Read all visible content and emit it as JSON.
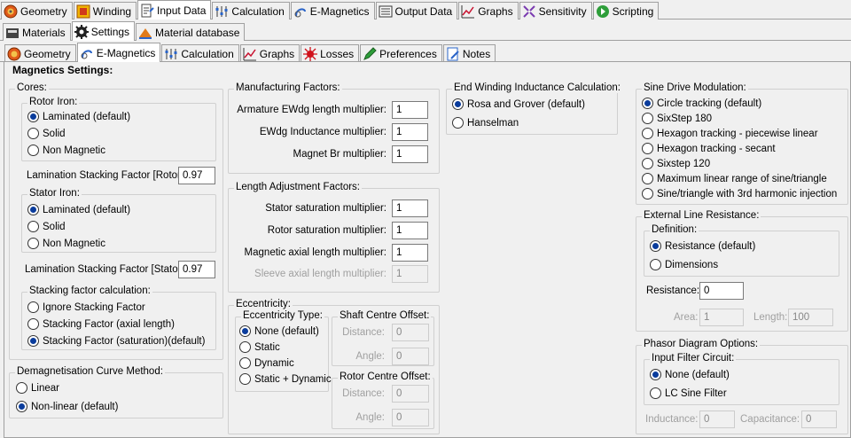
{
  "top_tabs": [
    {
      "label": "Geometry",
      "icon": "geometry-icon"
    },
    {
      "label": "Winding",
      "icon": "winding-icon"
    },
    {
      "label": "Input Data",
      "icon": "input-data-icon"
    },
    {
      "label": "Calculation",
      "icon": "calculation-icon"
    },
    {
      "label": "E-Magnetics",
      "icon": "e-magnetics-icon"
    },
    {
      "label": "Output Data",
      "icon": "output-data-icon"
    },
    {
      "label": "Graphs",
      "icon": "graphs-icon"
    },
    {
      "label": "Sensitivity",
      "icon": "sensitivity-icon"
    },
    {
      "label": "Scripting",
      "icon": "scripting-icon"
    }
  ],
  "second_tabs": [
    {
      "label": "Materials"
    },
    {
      "label": "Settings"
    },
    {
      "label": "Material database"
    }
  ],
  "third_tabs": [
    {
      "label": "Geometry"
    },
    {
      "label": "E-Magnetics"
    },
    {
      "label": "Calculation"
    },
    {
      "label": "Graphs"
    },
    {
      "label": "Losses"
    },
    {
      "label": "Preferences"
    },
    {
      "label": "Notes"
    }
  ],
  "title": "Magnetics Settings:",
  "cores": {
    "legend": "Cores:",
    "rotor_iron": {
      "legend": "Rotor Iron:",
      "options": [
        "Laminated (default)",
        "Solid",
        "Non Magnetic"
      ],
      "selected": 0
    },
    "rotor_stacking_label": "Lamination Stacking Factor [Rotor]:",
    "rotor_stacking_value": "0.97",
    "stator_iron": {
      "legend": "Stator Iron:",
      "options": [
        "Laminated (default)",
        "Solid",
        "Non Magnetic"
      ],
      "selected": 0
    },
    "stator_stacking_label": "Lamination Stacking Factor [Stator]:",
    "stator_stacking_value": "0.97",
    "stacking_calc": {
      "legend": "Stacking factor calculation:",
      "options": [
        "Ignore Stacking Factor",
        "Stacking Factor (axial length)",
        "Stacking Factor (saturation)(default)"
      ],
      "selected": 2
    }
  },
  "demag": {
    "legend": "Demagnetisation Curve Method:",
    "options": [
      "Linear",
      "Non-linear (default)"
    ],
    "selected": 1
  },
  "manufacturing": {
    "legend": "Manufacturing Factors:",
    "rows": [
      {
        "label": "Armature EWdg length multiplier:",
        "value": "1"
      },
      {
        "label": "EWdg Inductance multiplier:",
        "value": "1"
      },
      {
        "label": "Magnet Br multiplier:",
        "value": "1"
      }
    ]
  },
  "length_adjust": {
    "legend": "Length Adjustment Factors:",
    "rows": [
      {
        "label": "Stator saturation multiplier:",
        "value": "1"
      },
      {
        "label": "Rotor saturation multiplier:",
        "value": "1"
      },
      {
        "label": "Magnetic axial length multiplier:",
        "value": "1"
      },
      {
        "label": "Sleeve axial length multiplier:",
        "value": "1"
      }
    ]
  },
  "eccentricity": {
    "legend": "Eccentricity:",
    "type": {
      "legend": "Eccentricity Type:",
      "options": [
        "None (default)",
        "Static",
        "Dynamic",
        "Static + Dynamic"
      ],
      "selected": 0
    },
    "shaft": {
      "legend": "Shaft Centre Offset:",
      "distance_label": "Distance:",
      "distance": "0",
      "angle_label": "Angle:",
      "angle": "0"
    },
    "rotor": {
      "legend": "Rotor Centre Offset:",
      "distance_label": "Distance:",
      "distance": "0",
      "angle_label": "Angle:",
      "angle": "0"
    }
  },
  "end_winding": {
    "legend": "End Winding Inductance Calculation:",
    "options": [
      "Rosa and Grover (default)",
      "Hanselman"
    ],
    "selected": 0
  },
  "sine_drive": {
    "legend": "Sine Drive Modulation:",
    "options": [
      "Circle tracking (default)",
      "SixStep 180",
      "Hexagon tracking - piecewise linear",
      "Hexagon tracking - secant",
      "Sixstep 120",
      "Maximum linear range of sine/triangle",
      "Sine/triangle with 3rd harmonic injection"
    ],
    "selected": 0
  },
  "ext_line": {
    "legend": "External Line Resistance:",
    "definition": {
      "legend": "Definition:",
      "options": [
        "Resistance (default)",
        "Dimensions"
      ],
      "selected": 0
    },
    "resistance_label": "Resistance:",
    "resistance": "0",
    "area_label": "Area:",
    "area": "1",
    "length_label": "Length:",
    "length": "100"
  },
  "phasor": {
    "legend": "Phasor Diagram Options:",
    "filter": {
      "legend": "Input Filter Circuit:",
      "options": [
        "None (default)",
        "LC Sine Filter"
      ],
      "selected": 0
    },
    "inductance_label": "Inductance:",
    "inductance": "0",
    "capacitance_label": "Capacitance:",
    "capacitance": "0"
  }
}
